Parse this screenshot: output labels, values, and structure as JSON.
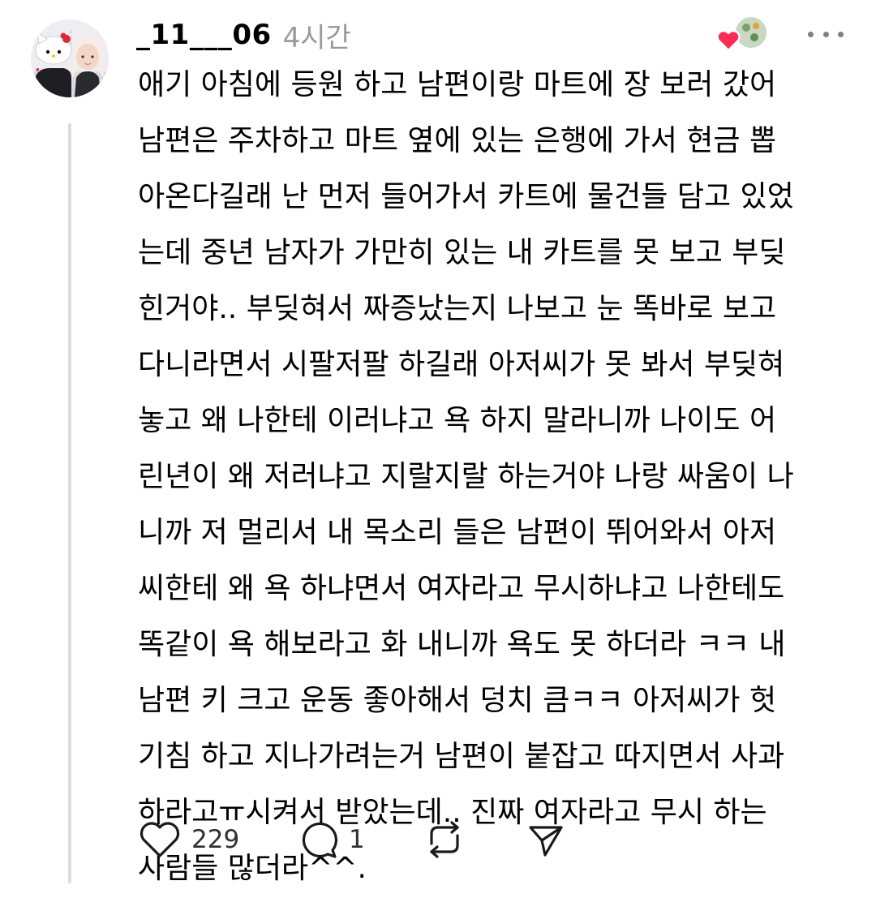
{
  "post": {
    "username": "_11___06",
    "time_ago": "4시간",
    "body_lines": [
      "애기 아침에 등원 하고 남편이랑 마트에 장 보러 갔어",
      "남편은 주차하고 마트 옆에 있는 은행에 가서 현금 뽑",
      "아온다길래 난 먼저 들어가서 카트에 물건들 담고 있었",
      "는데 중년 남자가 가만히 있는 내 카트를 못 보고 부딪",
      "힌거야.. 부딪혀서 짜증났는지 나보고 눈 똑바로 보고",
      "다니라면서 시팔저팔 하길래 아저씨가 못 봐서 부딪혀",
      "놓고 왜 나한테 이러냐고 욕 하지 말라니까 나이도 어",
      "린년이 왜 저러냐고 지랄지랄 하는거야 나랑 싸움이 나",
      "니까 저 멀리서 내 목소리 들은 남편이 뛰어와서 아저",
      "씨한테 왜 욕 하냐면서 여자라고 무시하냐고 나한테도",
      "똑같이 욕 해보라고 화 내니까 욕도 못 하더라 ㅋㅋ 내",
      "남편 키 크고 운동 좋아해서 덩치 큼ㅋㅋ 아저씨가 헛",
      "기침 하고 지나가려는거 남편이 붙잡고 따지면서 사과",
      "하라고ㅠ시켜서 받았는데.. 진짜 여자라고 무시 하는",
      "사람들 많더라^^."
    ],
    "like_count": "229",
    "reply_count": "1"
  },
  "icons": {
    "like": "heart-outline-icon",
    "reply": "speech-bubble-icon",
    "repost": "repost-arrows-icon",
    "share": "send-icon",
    "more": "more-dots-icon",
    "liked_by": "heart-badge-icon"
  },
  "colors": {
    "text": "#000000",
    "muted": "#9a9a9a",
    "heart_badge": "#ff2d55",
    "thread_line": "#dcdcdc"
  }
}
